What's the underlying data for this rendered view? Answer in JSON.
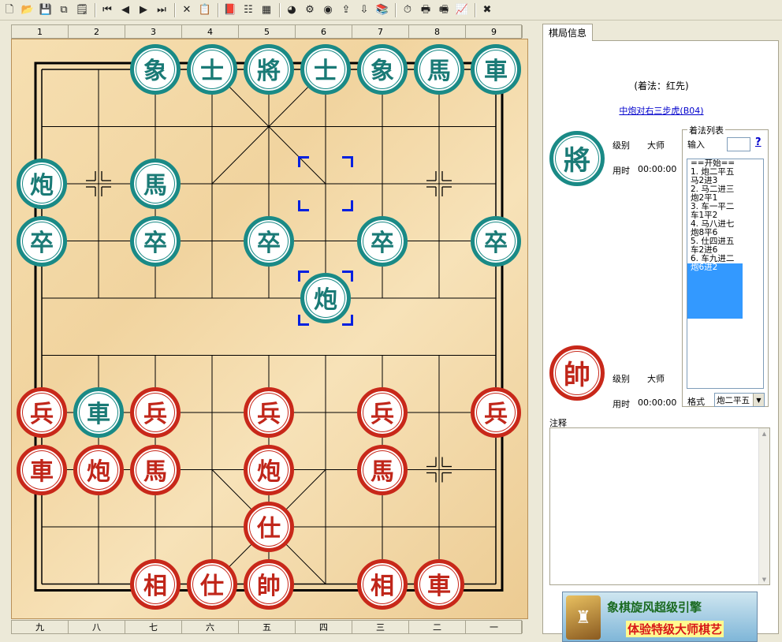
{
  "toolbar": {
    "buttons": [
      {
        "name": "new-file-icon",
        "glyph": "🗋"
      },
      {
        "name": "open-folder-icon",
        "glyph": "📂"
      },
      {
        "name": "save-icon",
        "glyph": "💾"
      },
      {
        "name": "copy-board-icon",
        "glyph": "⧉"
      },
      {
        "name": "properties-icon",
        "glyph": "🗒"
      },
      {
        "name": "first-move-icon",
        "glyph": "⏮"
      },
      {
        "name": "previous-move-icon",
        "glyph": "◀"
      },
      {
        "name": "next-move-icon",
        "glyph": "▶"
      },
      {
        "name": "last-move-icon",
        "glyph": "⏭"
      },
      {
        "name": "delete-icon",
        "glyph": "✕"
      },
      {
        "name": "paste-icon",
        "glyph": "📋"
      },
      {
        "name": "book-icon",
        "glyph": "📕"
      },
      {
        "name": "tree-icon",
        "glyph": "☷"
      },
      {
        "name": "grid-icon",
        "glyph": "▦"
      },
      {
        "name": "color-wheel-icon",
        "glyph": "◕"
      },
      {
        "name": "engine-icon",
        "glyph": "⚙"
      },
      {
        "name": "weibo-icon",
        "glyph": "◉"
      },
      {
        "name": "export-icon",
        "glyph": "⇪"
      },
      {
        "name": "import-icon",
        "glyph": "⇩"
      },
      {
        "name": "library-icon",
        "glyph": "📚"
      },
      {
        "name": "clock-icon",
        "glyph": "⏱"
      },
      {
        "name": "print-icon",
        "glyph": "🖶"
      },
      {
        "name": "print-preview-icon",
        "glyph": "🖷"
      },
      {
        "name": "chart-icon",
        "glyph": "📈"
      },
      {
        "name": "close-icon",
        "glyph": "✖"
      }
    ]
  },
  "rulers": {
    "top": [
      "1",
      "2",
      "3",
      "4",
      "5",
      "6",
      "7",
      "8",
      "9"
    ],
    "bottom": [
      "九",
      "八",
      "七",
      "六",
      "五",
      "四",
      "三",
      "二",
      "一"
    ]
  },
  "pieces": [
    {
      "side": "black",
      "char": "象",
      "col": 2,
      "row": 0
    },
    {
      "side": "black",
      "char": "士",
      "col": 3,
      "row": 0
    },
    {
      "side": "black",
      "char": "將",
      "col": 4,
      "row": 0
    },
    {
      "side": "black",
      "char": "士",
      "col": 5,
      "row": 0
    },
    {
      "side": "black",
      "char": "象",
      "col": 6,
      "row": 0
    },
    {
      "side": "black",
      "char": "馬",
      "col": 7,
      "row": 0
    },
    {
      "side": "black",
      "char": "車",
      "col": 8,
      "row": 0
    },
    {
      "side": "black",
      "char": "炮",
      "col": 0,
      "row": 2
    },
    {
      "side": "black",
      "char": "馬",
      "col": 2,
      "row": 2
    },
    {
      "side": "black",
      "char": "卒",
      "col": 0,
      "row": 3
    },
    {
      "side": "black",
      "char": "卒",
      "col": 2,
      "row": 3
    },
    {
      "side": "black",
      "char": "卒",
      "col": 4,
      "row": 3
    },
    {
      "side": "black",
      "char": "卒",
      "col": 6,
      "row": 3
    },
    {
      "side": "black",
      "char": "卒",
      "col": 8,
      "row": 3
    },
    {
      "side": "black",
      "char": "炮",
      "col": 5,
      "row": 4
    },
    {
      "side": "red",
      "char": "兵",
      "col": 0,
      "row": 6
    },
    {
      "side": "black",
      "char": "車",
      "col": 1,
      "row": 6
    },
    {
      "side": "red",
      "char": "兵",
      "col": 2,
      "row": 6
    },
    {
      "side": "red",
      "char": "兵",
      "col": 4,
      "row": 6
    },
    {
      "side": "red",
      "char": "兵",
      "col": 6,
      "row": 6
    },
    {
      "side": "red",
      "char": "兵",
      "col": 8,
      "row": 6
    },
    {
      "side": "red",
      "char": "車",
      "col": 0,
      "row": 7
    },
    {
      "side": "red",
      "char": "炮",
      "col": 1,
      "row": 7
    },
    {
      "side": "red",
      "char": "馬",
      "col": 2,
      "row": 7
    },
    {
      "side": "red",
      "char": "炮",
      "col": 4,
      "row": 7
    },
    {
      "side": "red",
      "char": "馬",
      "col": 6,
      "row": 7
    },
    {
      "side": "red",
      "char": "仕",
      "col": 4,
      "row": 8
    },
    {
      "side": "red",
      "char": "相",
      "col": 2,
      "row": 9
    },
    {
      "side": "red",
      "char": "仕",
      "col": 3,
      "row": 9
    },
    {
      "side": "red",
      "char": "帥",
      "col": 4,
      "row": 9
    },
    {
      "side": "red",
      "char": "相",
      "col": 6,
      "row": 9
    },
    {
      "side": "red",
      "char": "車",
      "col": 7,
      "row": 9
    }
  ],
  "selection": {
    "from": {
      "col": 5,
      "row": 2
    },
    "to": {
      "col": 5,
      "row": 4
    }
  },
  "panel": {
    "tab_label": "棋局信息",
    "move_type": "(着法：红先)",
    "opening": "中炮对右三步虎(B04)",
    "black_player": {
      "piece": "將",
      "level_label": "级别",
      "level": "大师",
      "time_label": "用时",
      "time": "00:00:00"
    },
    "red_player": {
      "piece": "帥",
      "level_label": "级别",
      "level": "大师",
      "time_label": "用时",
      "time": "00:00:00"
    },
    "moves_group_title": "着法列表",
    "input_label": "输入",
    "input_value": "",
    "help_glyph": "?",
    "moves": [
      "==开始==",
      "1. 炮二平五",
      "   马2进3",
      "2. 马二进三",
      "   炮2平1",
      "3. 车一平二",
      "   车1平2",
      "4. 马八进七",
      "   炮8平6",
      "5. 仕四进五",
      "   车2进6",
      "6. 车九进二",
      "   炮6进2"
    ],
    "selected_move_index": 12,
    "format_label": "格式",
    "format_value": "炮二平五",
    "notes_label": "注释",
    "banner_line1": "象棋旋风超级引擎",
    "banner_line2": "体验特级大师棋艺"
  },
  "colors": {
    "black_piece": "#1a8a86",
    "red_piece": "#c8281a",
    "selection": "#0020e0",
    "board": "#f3d9a8"
  }
}
